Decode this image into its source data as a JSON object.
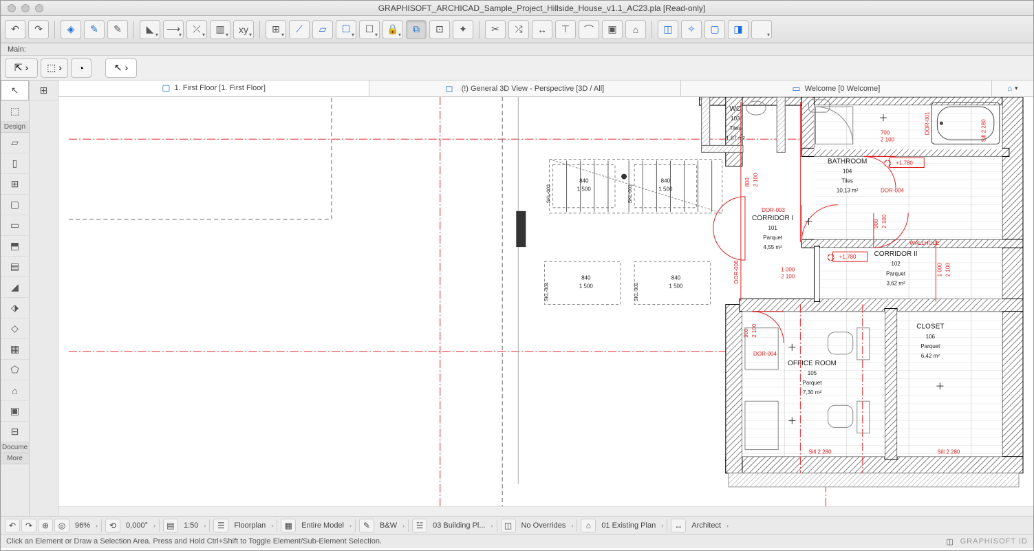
{
  "window": {
    "title": "GRAPHISOFT_ARCHICAD_Sample_Project_Hillside_House_v1.1_AC23.pla [Read-only]"
  },
  "labels": {
    "main": "Main:"
  },
  "tabs": {
    "t1": "1. First Floor [1. First Floor]",
    "t2": "(!) General 3D View - Perspective [3D / All]",
    "t3": "Welcome [0 Welcome]"
  },
  "tools": {
    "design": "Design",
    "docume": "Docume",
    "more": "More"
  },
  "quicknav": {
    "zoom": "96%",
    "angle": "0,000°",
    "scale": "1:50",
    "view": "Floorplan",
    "model": "Entire Model",
    "penset": "B&W",
    "layers": "03 Building Pl...",
    "overrides": "No Overrides",
    "renov": "01 Existing Plan",
    "dimstd": "Architect"
  },
  "status": {
    "hint": "Click an Element or Draw a Selection Area. Press and Hold Ctrl+Shift to Toggle Element/Sub-Element Selection.",
    "brand": "GRAPHISOFT ID"
  },
  "rooms": {
    "wc": {
      "name": "WC",
      "num": "103",
      "mat": "Tiles",
      "area": "1,87 m²"
    },
    "bath": {
      "name": "BATHROOM",
      "num": "104",
      "mat": "Tiles",
      "area": "10,13 m²"
    },
    "cor1": {
      "name": "CORRIDOR I",
      "num": "101",
      "mat": "Parquet",
      "area": "4,55 m²"
    },
    "cor2": {
      "name": "CORRIDOR II",
      "num": "102",
      "mat": "Parquet",
      "area": "3,62 m²"
    },
    "closet": {
      "name": "CLOSET",
      "num": "106",
      "mat": "Parquet",
      "area": "6,42 m²"
    },
    "office": {
      "name": "OFFICE ROOM",
      "num": "105",
      "mat": "Parquet",
      "area": "7,30 m²"
    }
  },
  "skylights": {
    "a": {
      "id": "SKL-003",
      "w": "840",
      "h": "1 500"
    },
    "b": {
      "id": "SKL-001",
      "w": "840",
      "h": "1 500"
    },
    "c": {
      "id": "SKL-004",
      "w": "840",
      "h": "1 500"
    },
    "d": {
      "id": "SKL-002",
      "w": "840",
      "h": "1 500"
    }
  },
  "doors": {
    "d1": "DOR-001",
    "d3": "DOR-003",
    "d4": "DOR-004",
    "d4b": "DOR-004",
    "d6": "DOR-006"
  },
  "dims": {
    "v800": "800",
    "v2100": "2 100",
    "v700": "700",
    "v900": "900",
    "v1000": "1 000",
    "sill": "Sill 2 280",
    "elev": "+1,780",
    "wallhole": "WALLHOLE"
  }
}
